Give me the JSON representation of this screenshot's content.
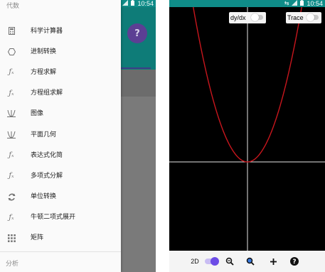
{
  "status_bar": {
    "icons": [
      "data-arrows-icon",
      "signal-icon",
      "battery-icon"
    ],
    "time": "10:54"
  },
  "drawer": {
    "header": "代数",
    "items": [
      {
        "label": "科学计算器",
        "icon": "calculator-icon"
      },
      {
        "label": "进制转换",
        "icon": "hexagon-icon"
      },
      {
        "label": "方程求解",
        "icon": "fx-icon"
      },
      {
        "label": "方程组求解",
        "icon": "fx-icon"
      },
      {
        "label": "图像",
        "icon": "graph-icon"
      },
      {
        "label": "平面几何",
        "icon": "graph-icon"
      },
      {
        "label": "表达式化简",
        "icon": "fx-icon"
      },
      {
        "label": "多项式分解",
        "icon": "fx-icon"
      },
      {
        "label": "单位转换",
        "icon": "convert-icon"
      },
      {
        "label": "牛顿二项式展开",
        "icon": "fx-icon"
      },
      {
        "label": "矩阵",
        "icon": "grid-icon"
      }
    ],
    "section": "分析"
  },
  "graph": {
    "dydx_label": "dy/dx",
    "trace_label": "Trace",
    "curve_color": "#c8161d"
  },
  "bottom_bar": {
    "mode_label": "2D"
  },
  "colors": {
    "status_bar": "#0f8c88",
    "accent": "#6c4ce6"
  }
}
